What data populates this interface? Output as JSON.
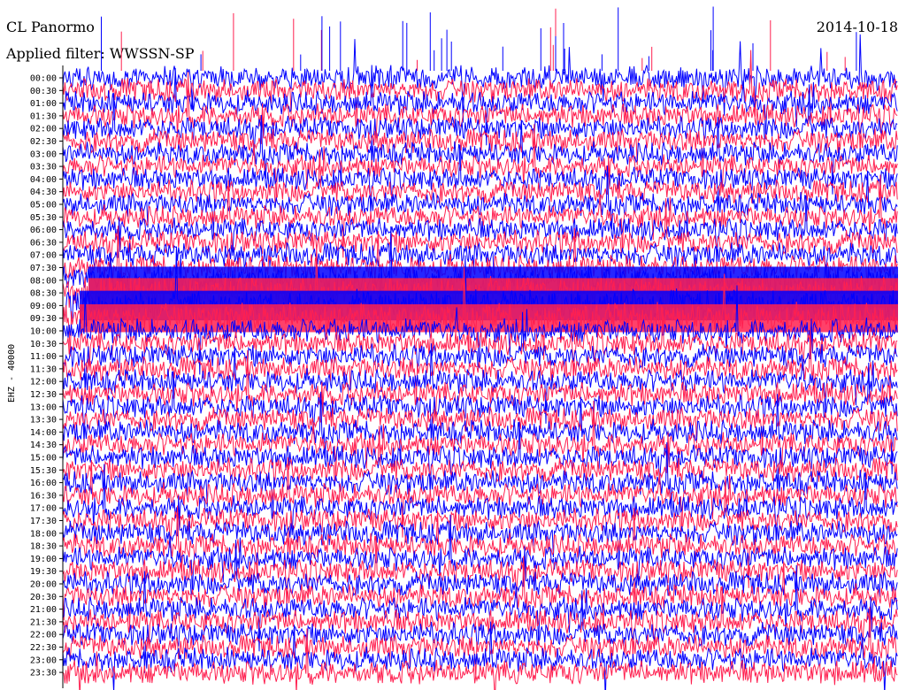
{
  "header": {
    "station": "CL Panormo",
    "date": "2014-10-18",
    "filter": "Applied filter: WWSSN-SP"
  },
  "chart_data": {
    "type": "line",
    "subtype": "helicorder",
    "channel_label": "EHZ - 40000",
    "row_labels": [
      "00:00",
      "00:30",
      "01:00",
      "01:30",
      "02:00",
      "02:30",
      "03:00",
      "03:30",
      "04:00",
      "04:30",
      "05:00",
      "05:30",
      "06:00",
      "06:30",
      "07:00",
      "07:30",
      "08:00",
      "08:30",
      "09:00",
      "09:30",
      "10:00",
      "10:30",
      "11:00",
      "11:30",
      "12:00",
      "12:30",
      "13:00",
      "13:30",
      "14:00",
      "14:30",
      "15:00",
      "15:30",
      "16:00",
      "16:30",
      "17:00",
      "17:30",
      "18:00",
      "18:30",
      "19:00",
      "19:30",
      "20:00",
      "20:30",
      "21:00",
      "21:30",
      "22:00",
      "22:30",
      "23:00",
      "23:30"
    ],
    "series_colors": [
      "#0000ff",
      "#ff2050"
    ],
    "axis_color": "#000000",
    "grid": false,
    "legend": "none",
    "amplitude_profile": [
      0.55,
      0.55,
      0.55,
      0.55,
      0.55,
      0.55,
      0.5,
      0.5,
      0.5,
      0.5,
      0.5,
      0.5,
      0.5,
      0.55,
      0.55,
      0.6,
      0.85,
      1.0,
      1.0,
      0.9,
      0.6,
      0.55,
      0.55,
      0.55,
      0.55,
      0.55,
      0.55,
      0.55,
      0.55,
      0.55,
      0.55,
      0.55,
      0.55,
      0.55,
      0.55,
      0.55,
      0.55,
      0.55,
      0.55,
      0.55,
      0.55,
      0.55,
      0.55,
      0.55,
      0.55,
      0.55,
      0.55,
      0.55
    ]
  }
}
